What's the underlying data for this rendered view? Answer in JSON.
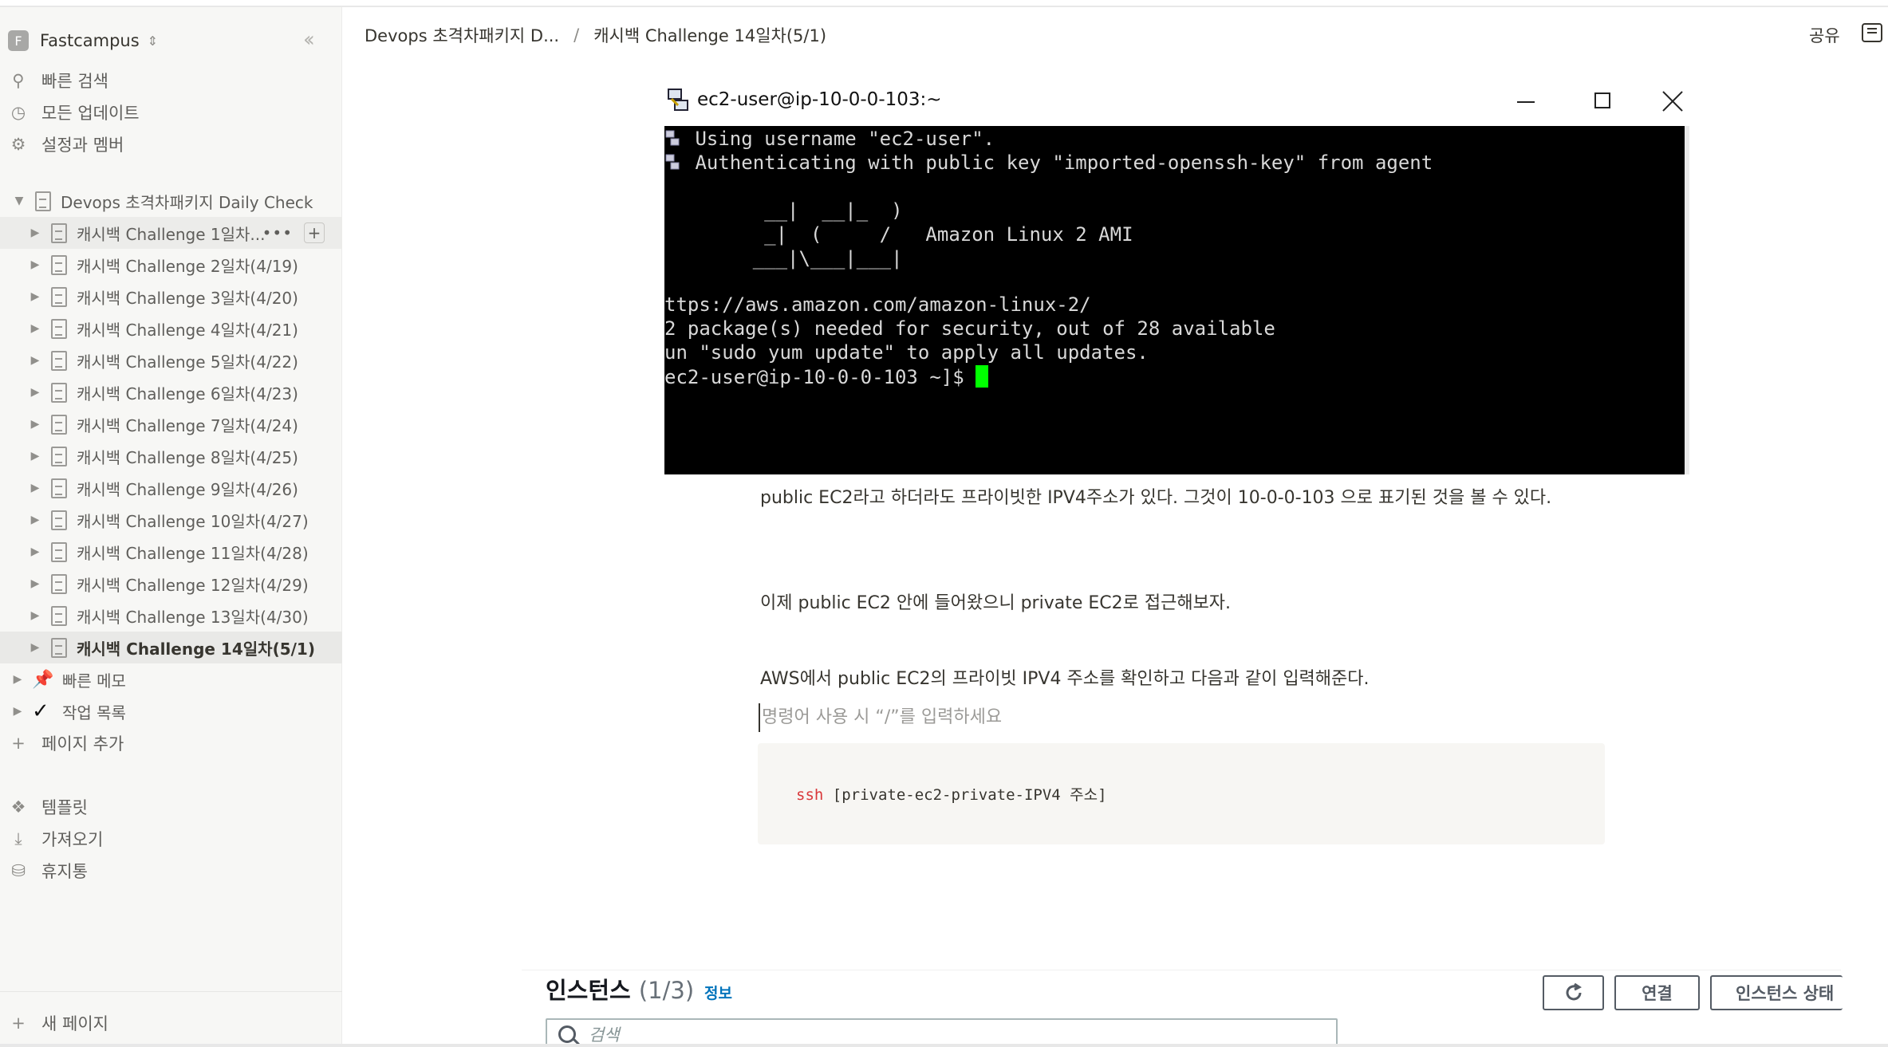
{
  "sidebar": {
    "workspace": {
      "badge": "F",
      "name": "Fastcampus"
    },
    "nav": [
      {
        "label": "빠른 검색",
        "icon": "search-icon"
      },
      {
        "label": "모든 업데이트",
        "icon": "clock-icon"
      },
      {
        "label": "설정과 멤버",
        "icon": "gear-icon"
      }
    ],
    "root_page": "Devops 초격차패키지 Daily Check",
    "pages": [
      "캐시백 Challenge 1일차...",
      "캐시백 Challenge 2일차(4/19)",
      "캐시백 Challenge 3일차(4/20)",
      "캐시백 Challenge 4일차(4/21)",
      "캐시백 Challenge 5일차(4/22)",
      "캐시백 Challenge 6일차(4/23)",
      "캐시백 Challenge 7일차(4/24)",
      "캐시백 Challenge 8일차(4/25)",
      "캐시백 Challenge 9일차(4/26)",
      "캐시백 Challenge 10일차(4/27)",
      "캐시백 Challenge 11일차(4/28)",
      "캐시백 Challenge 12일차(4/29)",
      "캐시백 Challenge 13일차(4/30)",
      "캐시백 Challenge 14일차(5/1)"
    ],
    "extra": [
      {
        "label": "빠른 메모",
        "icon": "pushpin-icon"
      },
      {
        "label": "작업 목록",
        "icon": "checkmark-icon"
      }
    ],
    "add_page": "페이지 추가",
    "tools": [
      {
        "label": "템플릿",
        "icon": "template-icon"
      },
      {
        "label": "가져오기",
        "icon": "download-icon"
      },
      {
        "label": "휴지통",
        "icon": "trash-icon"
      }
    ],
    "new_page": "새 페이지"
  },
  "header": {
    "breadcrumb": [
      "Devops 초격차패키지 D...",
      "캐시백 Challenge 14일차(5/1)"
    ],
    "share": "공유"
  },
  "terminal": {
    "title": "ec2-user@ip-10-0-0-103:~",
    "lines": [
      " Using username \"ec2-user\".",
      " Authenticating with public key \"imported-openssh-key\" from agent",
      "",
      "       __|  __|_  )",
      "       _|  (     /   Amazon Linux 2 AMI",
      "      ___|\\___|___|",
      "",
      "ttps://aws.amazon.com/amazon-linux-2/",
      "2 package(s) needed for security, out of 28 available",
      "un \"sudo yum update\" to apply all updates.",
      "ec2-user@ip-10-0-0-103 ~]$ "
    ]
  },
  "content": {
    "p1": "public EC2라고 하더라도 프라이빗한 IPV4주소가 있다. 그것이 10-0-0-103 으로 표기된 것을 볼 수 있다.",
    "p2": "이제 public EC2 안에 들어왔으니 private EC2로 접근해보자.",
    "p3": "AWS에서 public EC2의 프라이빗 IPV4 주소를 확인하고 다음과 같이 입력해준다.",
    "placeholder": "명령어 사용 시 “/”를 입력하세요",
    "code_kw": "ssh",
    "code_rest": " [private-ec2-private-IPV4 주소]"
  },
  "aws": {
    "title": "인스턴스",
    "count": "(1/3)",
    "info": "정보",
    "connect": "연결",
    "state": "인스턴스 상태",
    "search_placeholder": "검색"
  }
}
